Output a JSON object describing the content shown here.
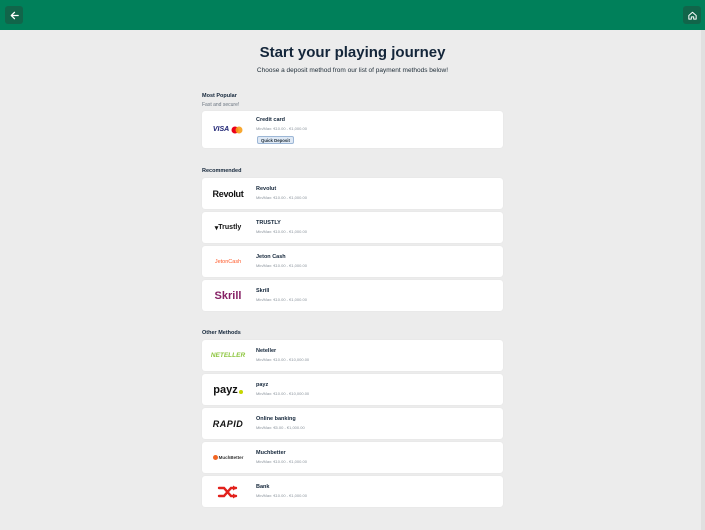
{
  "header": {
    "back_icon": "arrow-left-icon",
    "home_icon": "home-icon",
    "brand_color": "#00805a"
  },
  "main": {
    "title": "Start your playing journey",
    "subtitle": "Choose a deposit method from our list of payment methods below!"
  },
  "sections": {
    "popular": {
      "title": "Most Popular",
      "subtitle": "Fast and secure!",
      "methods": [
        {
          "name": "Credit card",
          "limits": "Min/Max: €10.00 - €1,000.00",
          "badge": "Quick Deposit",
          "logo": "VISA"
        }
      ]
    },
    "recommended": {
      "title": "Recommended",
      "methods": [
        {
          "name": "Revolut",
          "limits": "Min/Max: €10.00 - €1,000.00",
          "logo": "Revolut"
        },
        {
          "name": "TRUSTLY",
          "limits": "Min/Max: €10.00 - €1,000.00",
          "logo": "Trustly"
        },
        {
          "name": "Jeton Cash",
          "limits": "Min/Max: €10.00 - €1,000.00",
          "logo": "JetonCash"
        },
        {
          "name": "Skrill",
          "limits": "Min/Max: €10.00 - €1,000.00",
          "logo": "Skrill"
        }
      ]
    },
    "other": {
      "title": "Other Methods",
      "methods": [
        {
          "name": "Neteller",
          "limits": "Min/Max: €10.00 - €10,000.00",
          "logo": "NETELLER"
        },
        {
          "name": "payz",
          "limits": "Min/Max: €10.00 - €10,000.00",
          "logo": "payz"
        },
        {
          "name": "Online banking",
          "limits": "Min/Max: €5.00 - €1,000.00",
          "logo": "RAPID"
        },
        {
          "name": "Muchbetter",
          "limits": "Min/Max: €10.00 - €1,000.00",
          "logo": "MuchBetter"
        },
        {
          "name": "Bank",
          "limits": "Min/Max: €10.00 - €1,000.00",
          "logo": "bank-transfer-icon"
        }
      ]
    }
  }
}
